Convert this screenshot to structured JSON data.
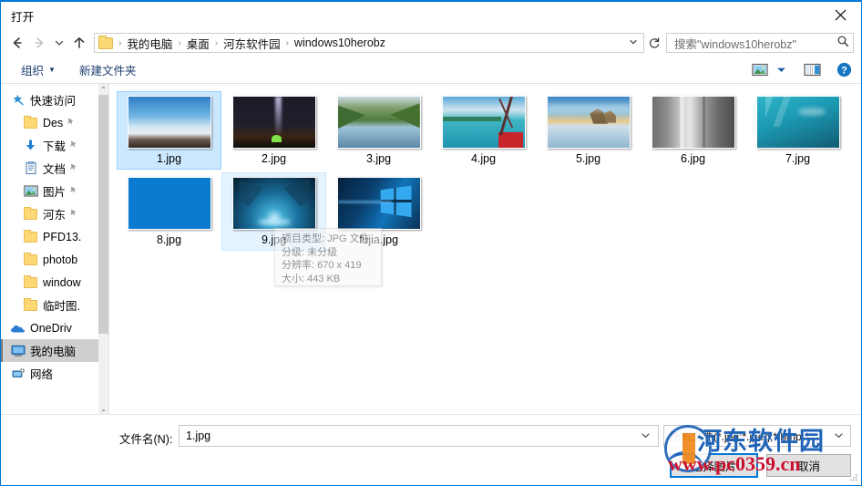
{
  "window": {
    "title": "打开",
    "close_label": "close-icon"
  },
  "nav": {
    "back": "←",
    "forward": "→",
    "recent": "⌄",
    "up": "↑",
    "refresh": "↻",
    "breadcrumb": [
      "我的电脑",
      "桌面",
      "河东软件园",
      "windows10herobz"
    ],
    "separator": "›",
    "dropdown_caret": "⌄"
  },
  "search": {
    "placeholder": "搜索\"windows10herobz\"",
    "icon": "search-icon"
  },
  "toolbar": {
    "organize_label": "组织",
    "organize_caret": "▼",
    "new_folder_label": "新建文件夹",
    "view_icon": "picture-view-icon",
    "view_caret": "▼",
    "preview_pane_icon": "preview-pane-icon",
    "help_icon": "help-icon"
  },
  "sidebar": {
    "items": [
      {
        "label": "快速访问",
        "icon": "star-pin-icon",
        "pinned": false,
        "child": false,
        "selected": false
      },
      {
        "label": "Des",
        "icon": "folder-icon",
        "pinned": true,
        "child": true,
        "selected": false
      },
      {
        "label": "下载",
        "icon": "download-icon",
        "pinned": true,
        "child": true,
        "selected": false
      },
      {
        "label": "文档",
        "icon": "document-icon",
        "pinned": true,
        "child": true,
        "selected": false
      },
      {
        "label": "图片",
        "icon": "picture-icon",
        "pinned": true,
        "child": true,
        "selected": false
      },
      {
        "label": "河东",
        "icon": "folder-icon",
        "pinned": true,
        "child": true,
        "selected": false
      },
      {
        "label": "PFD13.",
        "icon": "folder-icon",
        "pinned": false,
        "child": true,
        "selected": false
      },
      {
        "label": "photob",
        "icon": "folder-icon",
        "pinned": false,
        "child": true,
        "selected": false
      },
      {
        "label": "window",
        "icon": "folder-icon",
        "pinned": false,
        "child": true,
        "selected": false
      },
      {
        "label": "临时图.",
        "icon": "folder-icon",
        "pinned": false,
        "child": true,
        "selected": false
      },
      {
        "label": "OneDriv",
        "icon": "onedrive-icon",
        "pinned": false,
        "child": false,
        "selected": false
      },
      {
        "label": "我的电脑",
        "icon": "computer-icon",
        "pinned": false,
        "child": false,
        "selected": true
      },
      {
        "label": "网络",
        "icon": "network-icon",
        "pinned": false,
        "child": false,
        "selected": false
      }
    ],
    "scroll_up": "⌃",
    "scroll_down": "⌄"
  },
  "files": [
    {
      "name": "1.jpg",
      "state": "selected",
      "thumb": "mountain-cloudsea"
    },
    {
      "name": "2.jpg",
      "state": "normal",
      "thumb": "night-milkyway-tent"
    },
    {
      "name": "3.jpg",
      "state": "normal",
      "thumb": "green-lake-valley"
    },
    {
      "name": "4.jpg",
      "state": "normal",
      "thumb": "lagoon-red-boat"
    },
    {
      "name": "5.jpg",
      "state": "normal",
      "thumb": "beach-rock-reflection"
    },
    {
      "name": "6.jpg",
      "state": "normal",
      "thumb": "grey-cliff-bw"
    },
    {
      "name": "7.jpg",
      "state": "normal",
      "thumb": "underwater-teal"
    },
    {
      "name": "8.jpg",
      "state": "normal",
      "thumb": "solid-blue"
    },
    {
      "name": "9.jpg",
      "state": "hover",
      "thumb": "ice-cave-blue"
    },
    {
      "name": "fujia.jpg",
      "state": "normal",
      "thumb": "windows10-logo"
    }
  ],
  "tooltip": {
    "lines": [
      "项目类型: JPG 文件",
      "分级: 未分级",
      "分辨率: 670 x 419",
      "大小: 443 KB"
    ]
  },
  "footer": {
    "filename_label": "文件名(N):",
    "filename_value": "1.jpg",
    "filename_caret": "⌄",
    "filter_value": "所有文件(*.jpg;*.jpeg;*.bmp;*.",
    "filter_caret": "⌄",
    "ok_label": "选择图片",
    "cancel_label": "取消"
  },
  "watermark": {
    "brand": "河东软件园",
    "url": "www.pc0359.cn"
  },
  "colors": {
    "accent": "#0078d7",
    "selection": "#cce8ff",
    "hover": "#e5f3ff",
    "toolbar_text": "#1a3d6d"
  }
}
